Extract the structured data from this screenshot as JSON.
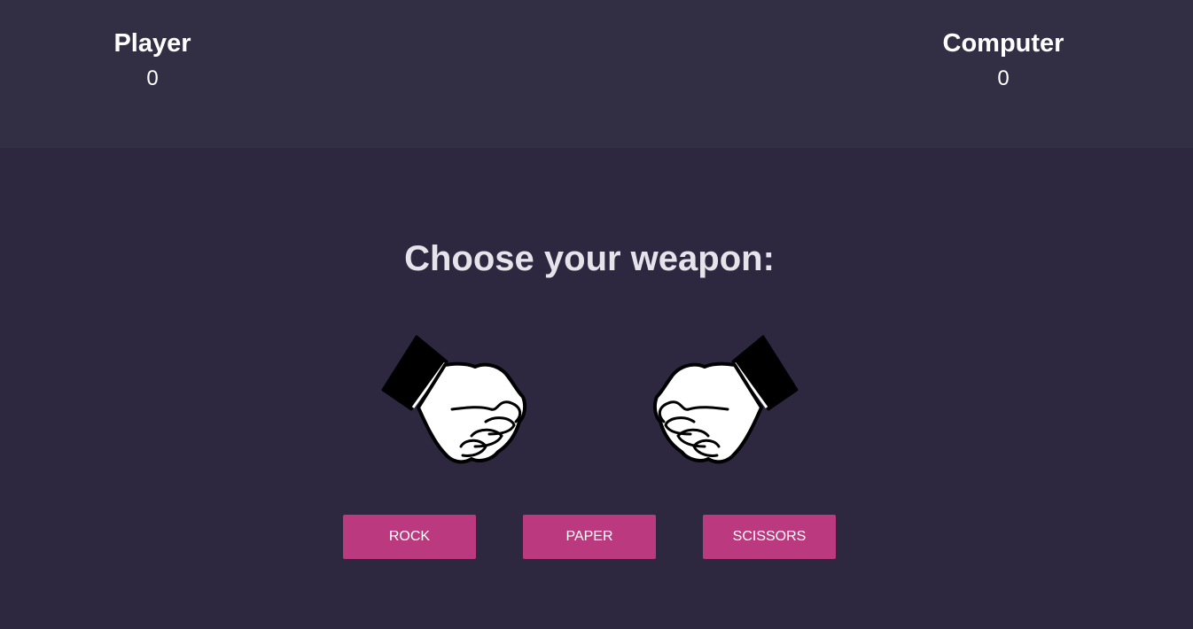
{
  "scoreboard": {
    "player": {
      "title": "Player",
      "score": "0"
    },
    "computer": {
      "title": "Computer",
      "score": "0"
    }
  },
  "prompt": "Choose your weapon:",
  "hands": {
    "player_icon": "fist-icon",
    "computer_icon": "fist-icon"
  },
  "buttons": {
    "rock": "ROCK",
    "paper": "PAPER",
    "scissors": "SCISSORS"
  },
  "colors": {
    "background": "#2d2840",
    "header_background": "#322e44",
    "button": "#bb3a7f",
    "text": "#ffffff"
  }
}
